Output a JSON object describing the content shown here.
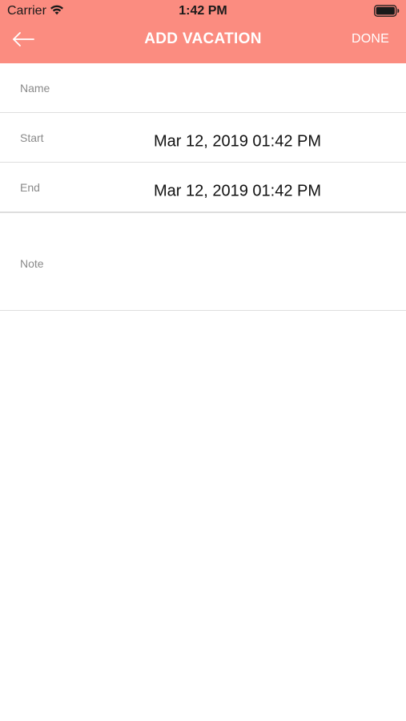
{
  "status_bar": {
    "carrier": "Carrier",
    "time": "1:42 PM",
    "wifi_icon": "wifi-icon",
    "battery_icon": "battery-icon"
  },
  "nav": {
    "title": "ADD VACATION",
    "done_label": "DONE",
    "back_icon": "arrow-left-icon"
  },
  "form": {
    "name": {
      "label": "Name",
      "value": ""
    },
    "start": {
      "label": "Start",
      "value": "Mar 12, 2019 01:42 PM"
    },
    "end": {
      "label": "End",
      "value": "Mar 12, 2019 01:42 PM"
    },
    "note": {
      "label": "Note",
      "value": ""
    }
  },
  "colors": {
    "header_bg": "#fb8c80",
    "header_text": "#ffffff",
    "label_text": "#8a8a8a",
    "value_text": "#111111",
    "divider": "#dedede"
  }
}
